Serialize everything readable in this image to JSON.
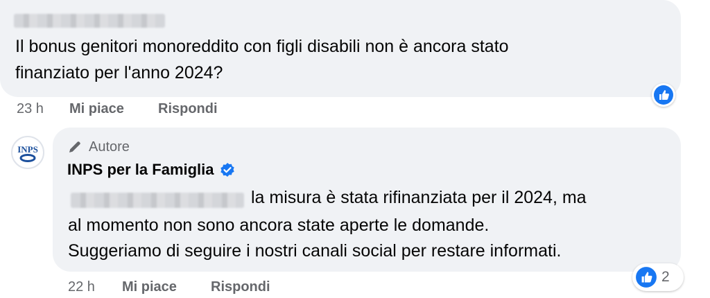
{
  "comment1": {
    "text_line1": "Il bonus genitori monoreddito con figli disabili non è ancora stato",
    "text_line2": "finanziato per l'anno 2024?",
    "time": "23 h",
    "like_label": "Mi piace",
    "reply_label": "Rispondi",
    "reaction": "like-icon"
  },
  "comment2": {
    "author_badge": "Autore",
    "author_icon": "pencil-icon",
    "author_name": "INPS per la Famiglia",
    "verified_icon": "verified-badge-icon",
    "avatar_text": "INPS",
    "text_line1": "la misura è stata rifinanziata per il 2024, ma",
    "text_line2": "al momento non sono ancora state aperte le domande.",
    "text_line3": "Suggeriamo di seguire i nostri canali social per restare informati.",
    "time": "22 h",
    "like_label": "Mi piace",
    "reply_label": "Rispondi",
    "reaction_count": "2",
    "reaction": "like-icon"
  },
  "colors": {
    "bubble": "#f0f2f5",
    "like_blue": "#1877f2",
    "meta_gray": "#65676b"
  }
}
